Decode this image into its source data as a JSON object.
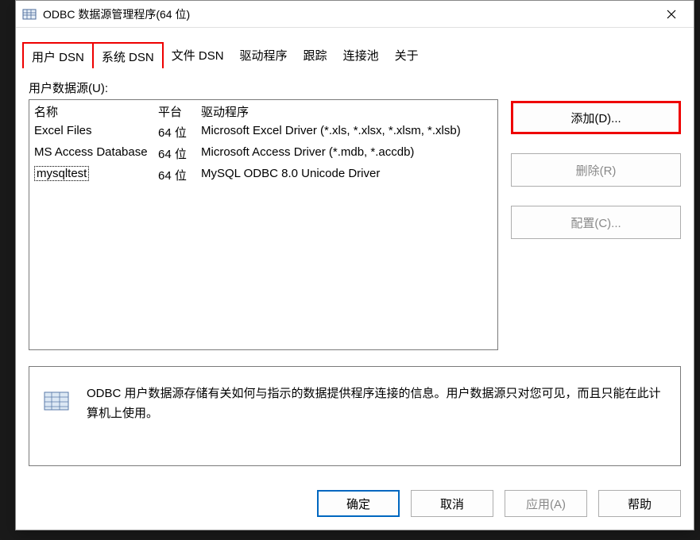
{
  "window": {
    "title": "ODBC 数据源管理程序(64 位)"
  },
  "tabs": [
    {
      "label": "用户 DSN"
    },
    {
      "label": "系统 DSN"
    },
    {
      "label": "文件 DSN"
    },
    {
      "label": "驱动程序"
    },
    {
      "label": "跟踪"
    },
    {
      "label": "连接池"
    },
    {
      "label": "关于"
    }
  ],
  "listLabel": "用户数据源(U):",
  "columns": {
    "name": "名称",
    "platform": "平台",
    "driver": "驱动程序"
  },
  "rows": [
    {
      "name": "Excel Files",
      "platform": "64 位",
      "driver": "Microsoft Excel Driver (*.xls, *.xlsx, *.xlsm, *.xlsb)"
    },
    {
      "name": "MS Access Database",
      "platform": "64 位",
      "driver": "Microsoft Access Driver (*.mdb, *.accdb)"
    },
    {
      "name": "mysqltest",
      "platform": "64 位",
      "driver": "MySQL ODBC 8.0 Unicode Driver"
    }
  ],
  "sideButtons": {
    "add": "添加(D)...",
    "remove": "删除(R)",
    "configure": "配置(C)..."
  },
  "infoText": "ODBC 用户数据源存储有关如何与指示的数据提供程序连接的信息。用户数据源只对您可见，而且只能在此计算机上使用。",
  "footer": {
    "ok": "确定",
    "cancel": "取消",
    "apply": "应用(A)",
    "help": "帮助"
  }
}
